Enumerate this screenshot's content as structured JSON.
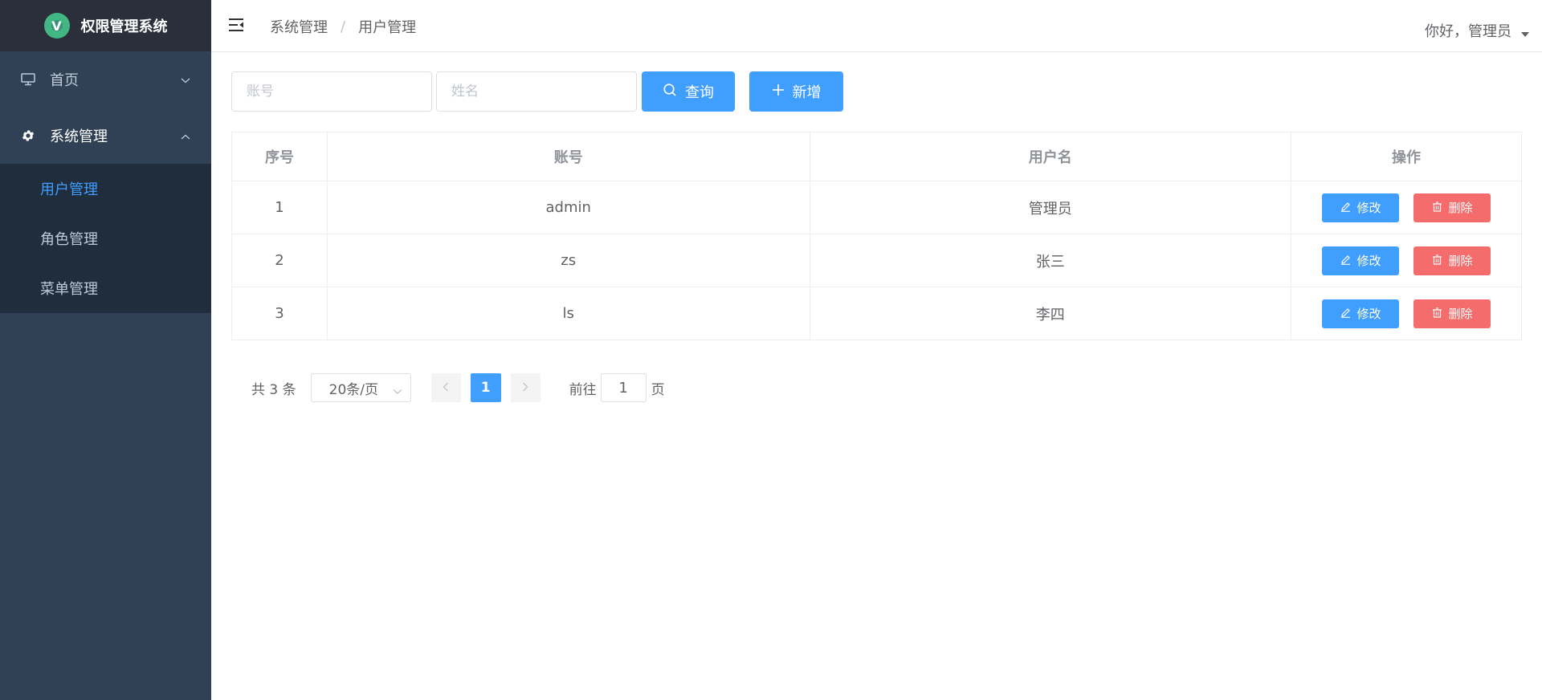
{
  "app": {
    "title": "权限管理系统",
    "logo_letter": "V"
  },
  "sidebar": {
    "items": [
      {
        "label": "首页",
        "icon": "monitor-icon",
        "expanded": false
      },
      {
        "label": "系统管理",
        "icon": "gear-icon",
        "expanded": true,
        "children": [
          {
            "label": "用户管理",
            "active": true
          },
          {
            "label": "角色管理",
            "active": false
          },
          {
            "label": "菜单管理",
            "active": false
          }
        ]
      }
    ]
  },
  "header": {
    "breadcrumb": [
      "系统管理",
      "用户管理"
    ],
    "separator": "/",
    "greeting": "你好，管理员"
  },
  "search": {
    "account_placeholder": "账号",
    "name_placeholder": "姓名",
    "query_label": "查询",
    "add_label": "新增"
  },
  "table": {
    "headers": [
      "序号",
      "账号",
      "用户名",
      "操作"
    ],
    "rows": [
      {
        "index": "1",
        "account": "admin",
        "username": "管理员"
      },
      {
        "index": "2",
        "account": "zs",
        "username": "张三"
      },
      {
        "index": "3",
        "account": "ls",
        "username": "李四"
      }
    ],
    "edit_label": "修改",
    "delete_label": "删除"
  },
  "pagination": {
    "total_text": "共 3 条",
    "page_size": "20条/页",
    "current_page": "1",
    "goto_label": "前往",
    "goto_value": "1",
    "goto_suffix": "页"
  },
  "colors": {
    "sidebar_bg": "#304156",
    "logo_bg": "#2b2f3a",
    "submenu_bg": "#1f2d3d",
    "primary": "#409eff",
    "danger": "#f56c6c",
    "logo_green": "#41b883"
  }
}
